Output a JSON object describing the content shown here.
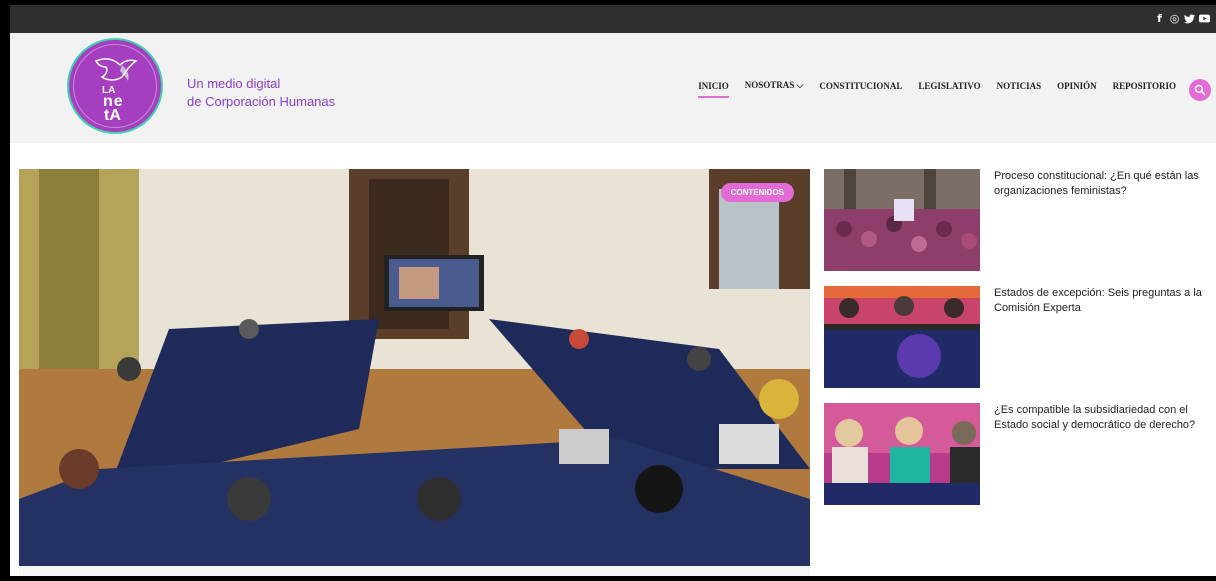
{
  "social": {
    "icons": [
      "facebook-icon",
      "instagram-icon",
      "twitter-icon",
      "youtube-icon"
    ],
    "glyphs": [
      "f",
      "◎",
      "🐦",
      "▶"
    ]
  },
  "header": {
    "logo_text_1": "LA",
    "logo_text_2": "ne",
    "logo_text_3": "tA",
    "tagline_line1": "Un medio digital",
    "tagline_line2": "de Corporación Humanas"
  },
  "nav": {
    "items": [
      {
        "label": "INICIO",
        "active": true
      },
      {
        "label": "NOSOTRAS ⌵",
        "active": false
      },
      {
        "label": "CONSTITUCIONAL",
        "active": false
      },
      {
        "label": "LEGISLATIVO",
        "active": false
      },
      {
        "label": "NOTICIAS",
        "active": false
      },
      {
        "label": "OPINIÓN",
        "active": false
      },
      {
        "label": "REPOSITORIO",
        "active": false
      }
    ]
  },
  "hero": {
    "badge": "CONTENIDOS"
  },
  "side_articles": [
    {
      "title": "Proceso constitucional: ¿En qué están las organizaciones feministas?"
    },
    {
      "title": "Estados de excepción: Seis preguntas a la Comisión Experta"
    },
    {
      "title": "¿Es compatible la subsidiariedad con el Estado social y democrático de derecho?"
    }
  ],
  "colors": {
    "accent": "#e46ad6",
    "tagline": "#8b3fd0",
    "logo_bg": "#a63fbf",
    "logo_ring": "#3fd3b0",
    "topbar": "#2f2f2f"
  }
}
